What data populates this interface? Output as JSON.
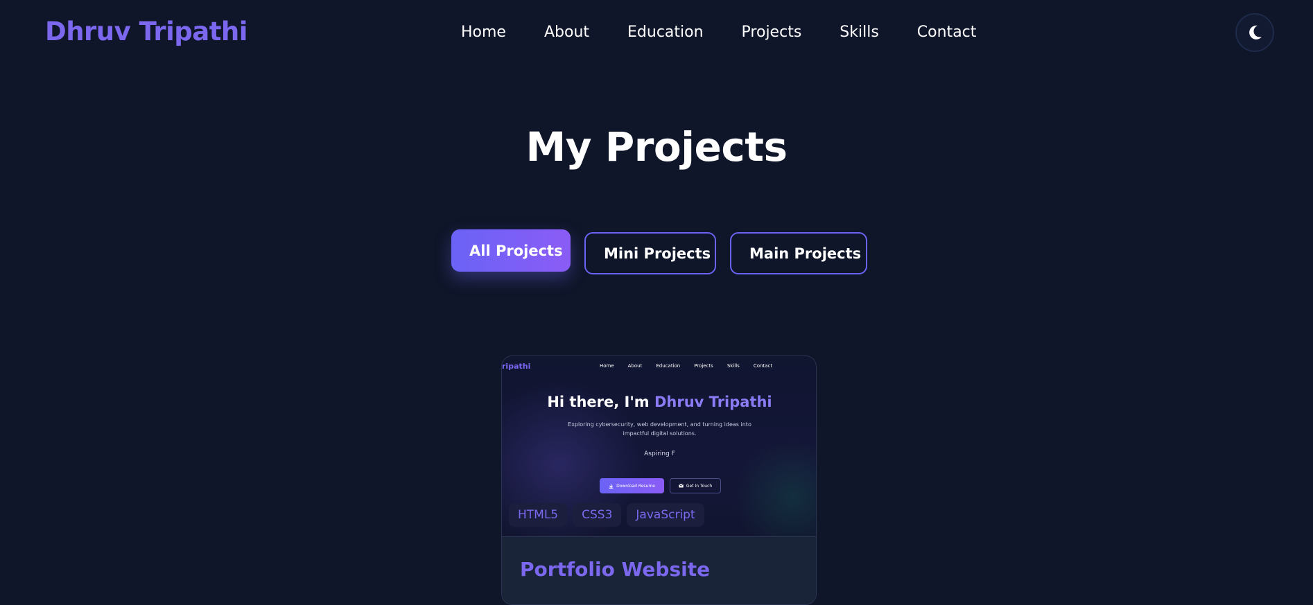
{
  "header": {
    "logo": "Dhruv Tripathi",
    "nav": [
      "Home",
      "About",
      "Education",
      "Projects",
      "Skills",
      "Contact"
    ],
    "theme_toggle_icon": "moon-icon"
  },
  "projects_section": {
    "title": "My Projects",
    "filters": [
      "All Projects",
      "Mini Projects",
      "Main Projects"
    ],
    "active_filter": "All Projects"
  },
  "project_card": {
    "preview": {
      "logo": "ripathi",
      "nav": [
        "Home",
        "About",
        "Education",
        "Projects",
        "Skills",
        "Contact"
      ],
      "hero_prefix": "Hi there, I'm ",
      "hero_name": "Dhruv Tripathi",
      "subtitle": "Exploring cybersecurity, web development, and turning ideas into impactful digital solutions.",
      "typing_text": "Aspiring F",
      "primary_button": "Download Resume",
      "secondary_button": "Get In Touch"
    },
    "tags": [
      "HTML5",
      "CSS3",
      "JavaScript"
    ],
    "title": "Portfolio Website"
  },
  "colors": {
    "background": "#0f1629",
    "accent": "#7b68ee",
    "gradient_start": "#6a63f5",
    "gradient_end": "#8b5cf6",
    "card_body": "#1a2438"
  }
}
